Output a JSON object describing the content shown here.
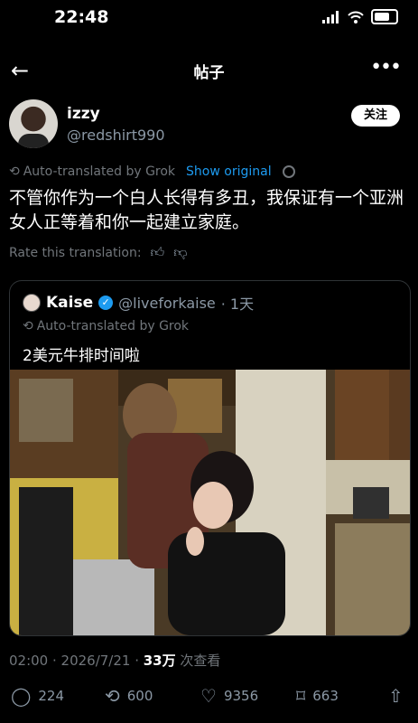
{
  "status": {
    "time": "22:48"
  },
  "nav": {
    "title": "帖子"
  },
  "author": {
    "name": "izzy",
    "handle": "@redshirt990",
    "follow_label": "关注"
  },
  "post": {
    "auto_translated": "Auto-translated by Grok",
    "show_original": "Show original",
    "text": "不管你作为一个白人长得有多丑，我保证有一个亚洲女人正等着和你一起建立家庭。",
    "rate_label": "Rate this translation:"
  },
  "quote": {
    "name": "Kaise",
    "handle": "@liveforkaise",
    "time": "· 1天",
    "auto_translated": "Auto-translated by Grok",
    "text": "2美元牛排时间啦"
  },
  "meta": {
    "time_date": "02:00 · 2026/7/21 · ",
    "views": "33万",
    "views_label": " 次查看"
  },
  "actions": {
    "replies": "224",
    "reposts": "600",
    "likes": "9356",
    "bookmarks": "663"
  },
  "colors": {
    "accent": "#1d9bf0",
    "muted": "#71767b"
  }
}
